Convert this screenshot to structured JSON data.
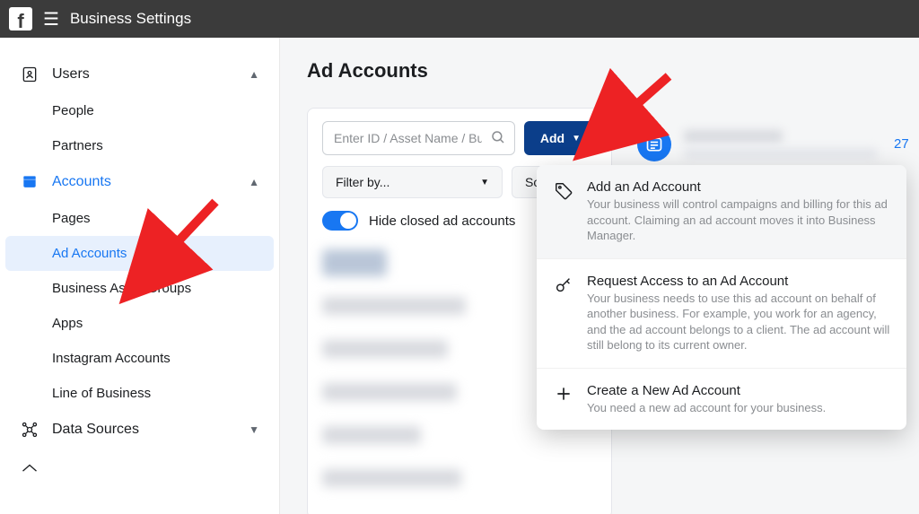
{
  "header": {
    "title": "Business Settings"
  },
  "sidebar": {
    "sections": [
      {
        "label": "Users",
        "expanded": true,
        "items": [
          {
            "label": "People"
          },
          {
            "label": "Partners"
          }
        ]
      },
      {
        "label": "Accounts",
        "expanded": true,
        "active": true,
        "items": [
          {
            "label": "Pages"
          },
          {
            "label": "Ad Accounts",
            "selected": true
          },
          {
            "label": "Business Asset Groups"
          },
          {
            "label": "Apps"
          },
          {
            "label": "Instagram Accounts"
          },
          {
            "label": "Line of Business"
          }
        ]
      },
      {
        "label": "Data Sources",
        "expanded": false
      }
    ]
  },
  "main": {
    "title": "Ad Accounts",
    "search": {
      "placeholder": "Enter ID / Asset Name / Bu…"
    },
    "add_label": "Add",
    "filter_label": "Filter by...",
    "sort_label": "Sort By...",
    "toggle_label": "Hide closed ad accounts",
    "detail_count": "27"
  },
  "dropdown": {
    "items": [
      {
        "title": "Add an Ad Account",
        "desc": "Your business will control campaigns and billing for this ad account. Claiming an ad account moves it into Business Manager.",
        "icon": "tag",
        "highlight": true
      },
      {
        "title": "Request Access to an Ad Account",
        "desc": "Your business needs to use this ad account on behalf of another business. For example, you work for an agency, and the ad account belongs to a client. The ad account will still belong to its current owner.",
        "icon": "key"
      },
      {
        "title": "Create a New Ad Account",
        "desc": "You need a new ad account for your business.",
        "icon": "plus"
      }
    ]
  }
}
